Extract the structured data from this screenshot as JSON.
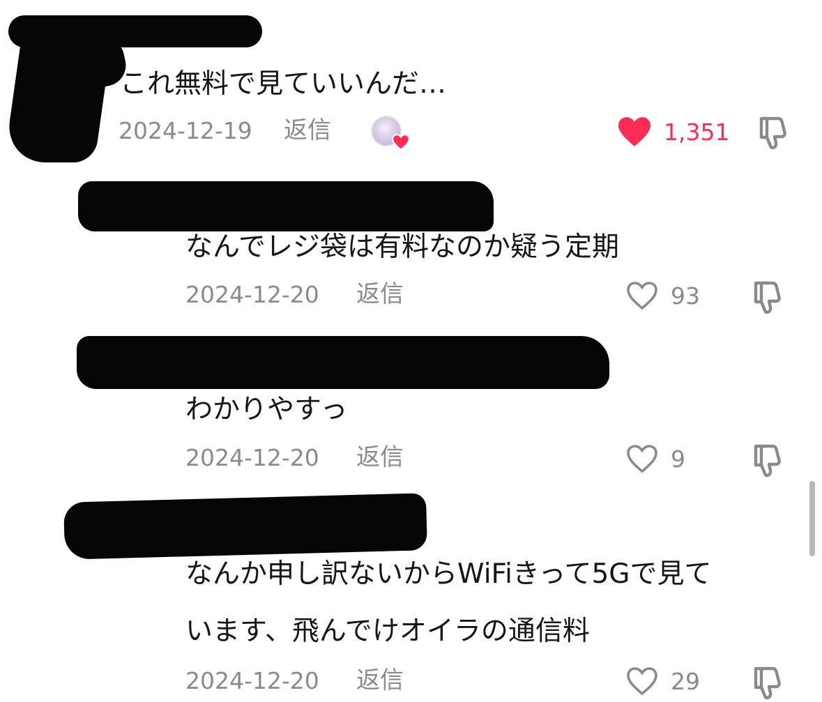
{
  "comments": [
    {
      "text": "これ無料で見ていいんだ…",
      "date": "2024-12-19",
      "reply_label": "返信",
      "likes": "1,351",
      "liked": true,
      "creator_liked": true
    },
    {
      "text": "なんでレジ袋は有料なのか疑う定期",
      "date": "2024-12-20",
      "reply_label": "返信",
      "likes": "93",
      "liked": false
    },
    {
      "text": "わかりやすっ",
      "date": "2024-12-20",
      "reply_label": "返信",
      "likes": "9",
      "liked": false
    },
    {
      "text_lines": [
        "なんか申し訳ないからWiFiきって5Gで見て",
        "います、飛んでけオイラの通信料"
      ],
      "date": "2024-12-20",
      "reply_label": "返信",
      "likes": "29",
      "liked": false
    }
  ],
  "icons": {
    "like": "heart-icon",
    "dislike": "thumbs-down-icon"
  },
  "colors": {
    "like_active": "#fe2c55",
    "meta_text": "#8a8a8a",
    "comment_text": "#161616"
  }
}
